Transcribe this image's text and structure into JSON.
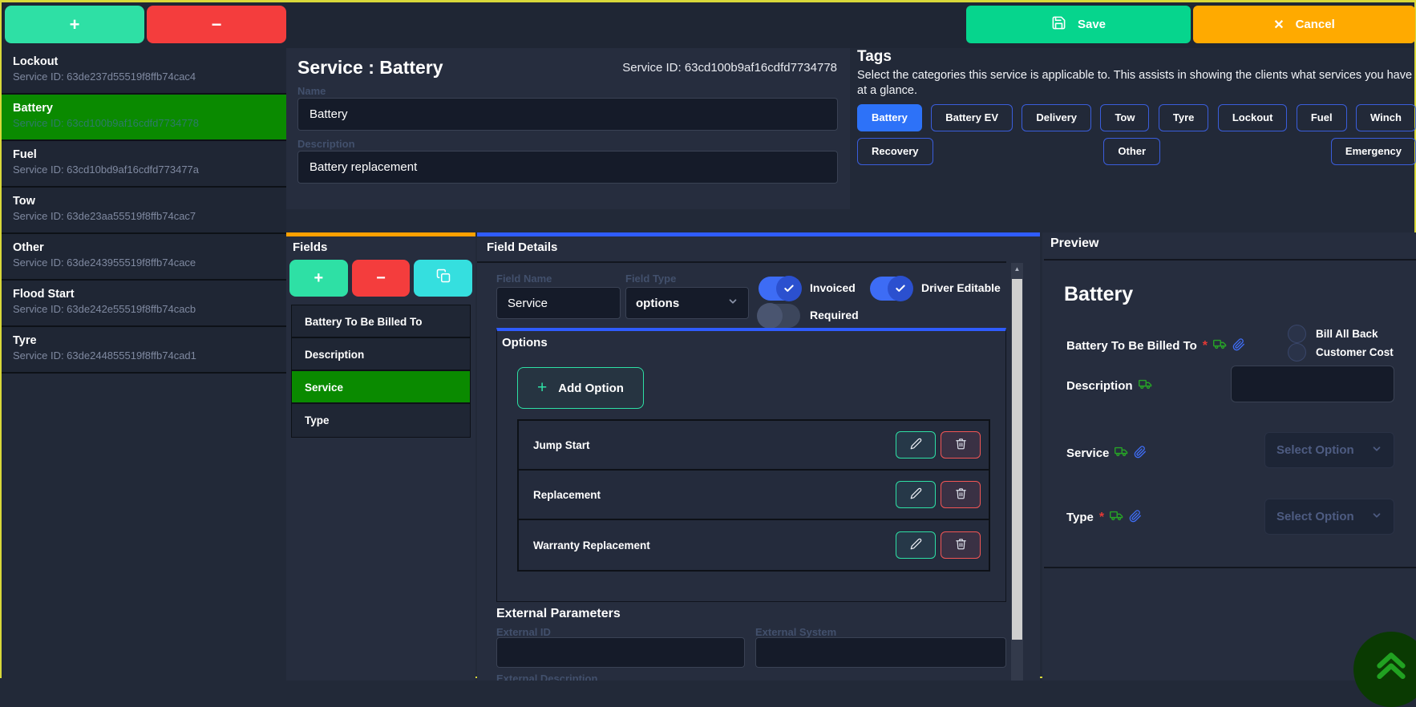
{
  "toolbar": {
    "add_label": "+",
    "remove_label": "−",
    "save_label": "Save",
    "cancel_label": "Cancel"
  },
  "sidebar": {
    "items": [
      {
        "name": "Lockout",
        "service_id": "Service ID: 63de237d55519f8ffb74cac4",
        "selected": false
      },
      {
        "name": "Battery",
        "service_id": "Service ID: 63cd100b9af16cdfd7734778",
        "selected": true
      },
      {
        "name": "Fuel",
        "service_id": "Service ID: 63cd10bd9af16cdfd773477a",
        "selected": false
      },
      {
        "name": "Tow",
        "service_id": "Service ID: 63de23aa55519f8ffb74cac7",
        "selected": false
      },
      {
        "name": "Other",
        "service_id": "Service ID: 63de243955519f8ffb74cace",
        "selected": false
      },
      {
        "name": "Flood Start",
        "service_id": "Service ID: 63de242e55519f8ffb74cacb",
        "selected": false
      },
      {
        "name": "Tyre",
        "service_id": "Service ID: 63de244855519f8ffb74cad1",
        "selected": false
      }
    ]
  },
  "service_editor": {
    "title": "Service : Battery",
    "service_id": "Service ID: 63cd100b9af16cdfd7734778",
    "name_label": "Name",
    "name_value": "Battery",
    "description_label": "Description",
    "description_value": "Battery replacement"
  },
  "tags": {
    "title": "Tags",
    "description": "Select the categories this service is applicable to. This assists in showing the clients what services you have at a glance.",
    "items": [
      {
        "label": "Battery",
        "selected": true
      },
      {
        "label": "Battery EV",
        "selected": false
      },
      {
        "label": "Delivery",
        "selected": false
      },
      {
        "label": "Tow",
        "selected": false
      },
      {
        "label": "Tyre",
        "selected": false
      },
      {
        "label": "Lockout",
        "selected": false
      },
      {
        "label": "Fuel",
        "selected": false
      },
      {
        "label": "Winch",
        "selected": false
      },
      {
        "label": "Recovery",
        "selected": false
      },
      {
        "label": "Other",
        "selected": false
      },
      {
        "label": "Emergency",
        "selected": false
      }
    ]
  },
  "fields_panel": {
    "title": "Fields",
    "items": [
      {
        "label": "Battery To Be Billed To",
        "selected": false
      },
      {
        "label": "Description",
        "selected": false
      },
      {
        "label": "Service",
        "selected": true
      },
      {
        "label": "Type",
        "selected": false
      }
    ]
  },
  "field_details": {
    "title": "Field Details",
    "field_name_label": "Field Name",
    "field_name_value": "Service",
    "field_type_label": "Field Type",
    "field_type_value": "options",
    "toggles": [
      {
        "label": "Invoiced",
        "on": true
      },
      {
        "label": "Required",
        "on": false
      },
      {
        "label": "Driver Editable",
        "on": true
      }
    ],
    "options": {
      "title": "Options",
      "add_label": "Add Option",
      "items": [
        "Jump Start",
        "Replacement",
        "Warranty Replacement"
      ]
    },
    "external": {
      "title": "External Parameters",
      "id_label": "External ID",
      "system_label": "External System",
      "description_label": "External Description"
    }
  },
  "preview": {
    "title": "Preview",
    "heading": "Battery",
    "select_placeholder": "Select Option",
    "fields": [
      {
        "label": "Battery To Be Billed To",
        "required": true
      },
      {
        "label": "Description",
        "required": false
      },
      {
        "label": "Service",
        "required": false
      },
      {
        "label": "Type",
        "required": true
      }
    ],
    "billing_options": [
      "Bill All Back",
      "Customer Cost"
    ]
  },
  "colors": {
    "accent_green": "#2ee0a5",
    "accent_red": "#f43d3d",
    "accent_cyan": "#35dfdf",
    "save_green": "#06d58d",
    "cancel_orange": "#ffaa00",
    "selected_green": "#0a8a00",
    "tag_blue": "#2d72f8",
    "panel_blue_border": "#2f5cff",
    "panel_orange_border": "#ffa000",
    "page_border_yellow": "#d8d83a"
  }
}
